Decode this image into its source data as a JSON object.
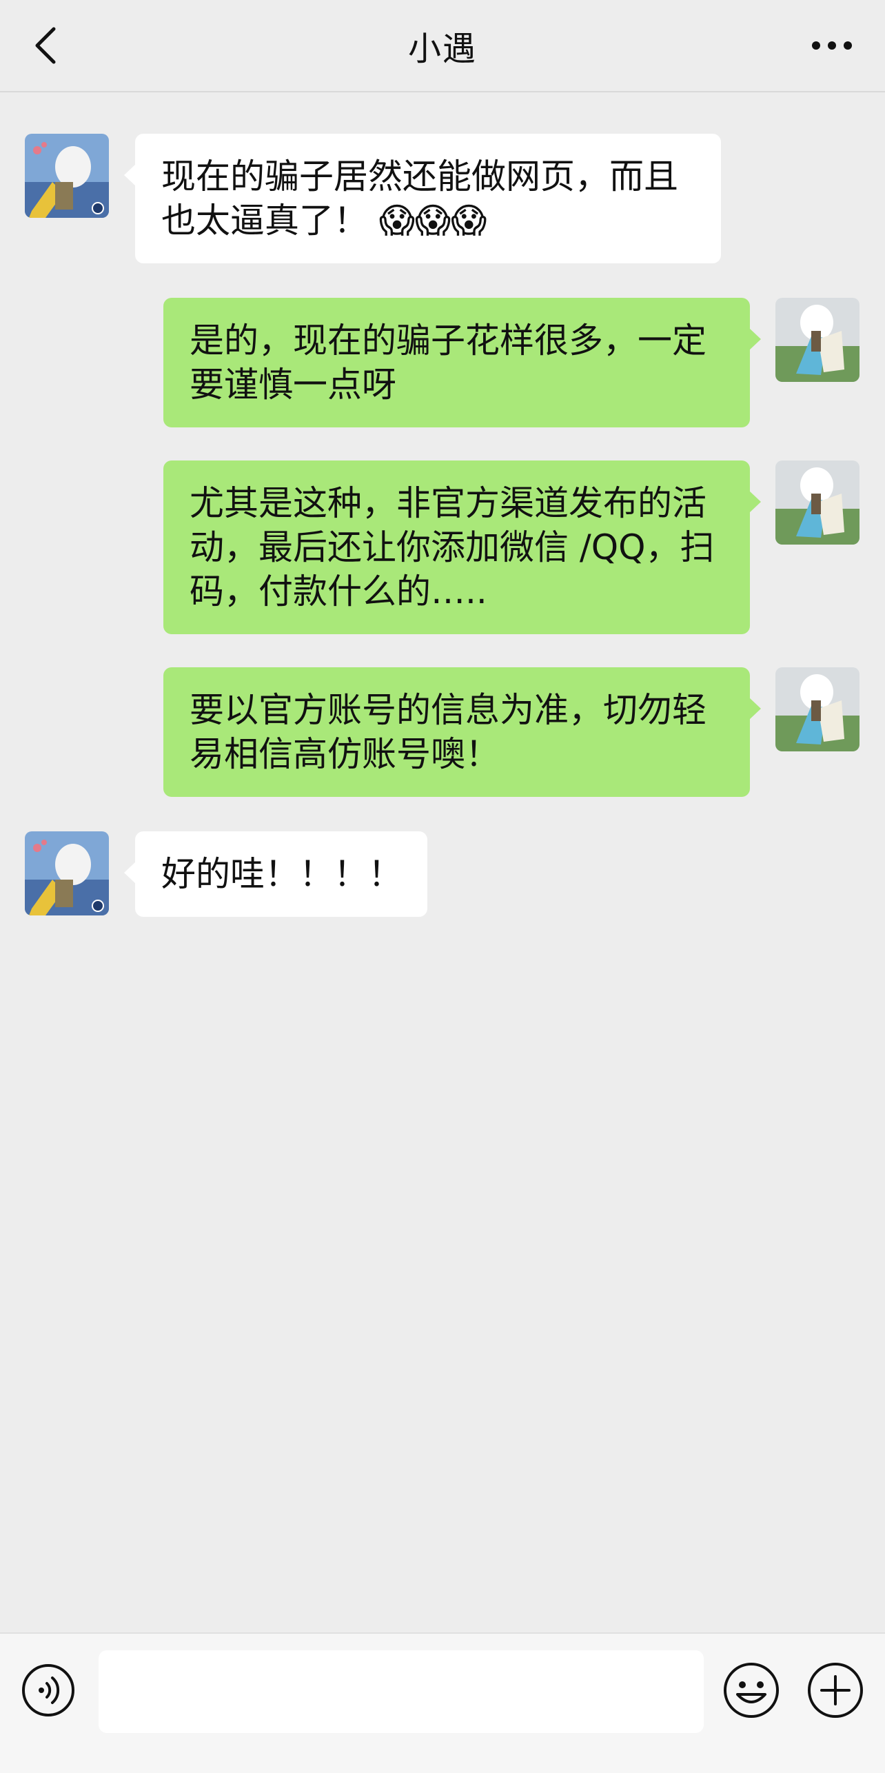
{
  "nav": {
    "title": "小遇",
    "back_icon": "chevron-left-icon",
    "more_icon": "ellipsis-icon"
  },
  "messages": [
    {
      "side": "in",
      "text": "现在的骗子居然还能做网页，而且也太逼真了！",
      "emoji": "😱😱😱"
    },
    {
      "side": "out",
      "text": "是的，现在的骗子花样很多，一定要谨慎一点呀"
    },
    {
      "side": "out",
      "text": "尤其是这种，非官方渠道发布的活动，最后还让你添加微信 /QQ，扫码，付款什么的….."
    },
    {
      "side": "out",
      "text": "要以官方账号的信息为准，切勿轻易相信高仿账号噢！"
    },
    {
      "side": "in",
      "text": "好的哇！！！！"
    }
  ],
  "input": {
    "value": "",
    "voice_icon": "voice-icon",
    "emoji_icon": "emoji-icon",
    "plus_icon": "plus-circle-icon"
  },
  "colors": {
    "background": "#ededed",
    "bubble_out": "#a9e879",
    "bubble_in": "#ffffff"
  }
}
